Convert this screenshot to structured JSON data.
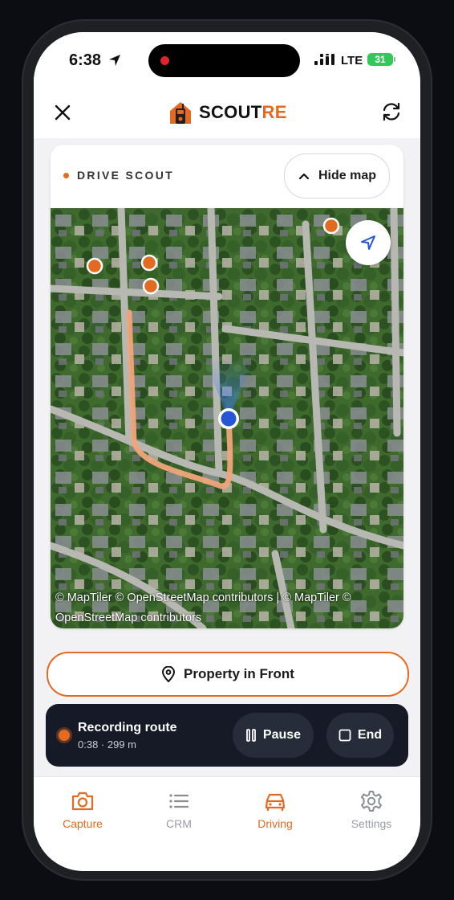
{
  "status_bar": {
    "time": "6:38",
    "network": "LTE",
    "battery": "31"
  },
  "header": {
    "brand_main": "SCOUT",
    "brand_accent": "RE"
  },
  "map_card": {
    "title": "DRIVE SCOUT",
    "hide_map_label": "Hide map",
    "attribution": "© MapTiler © OpenStreetMap contributors | © MapTiler © OpenStreetMap contributors"
  },
  "actions": {
    "property_in_front_label": "Property in Front"
  },
  "recording": {
    "title": "Recording route",
    "details": "0:38 · 299 m",
    "pause_label": "Pause",
    "end_label": "End"
  },
  "nav": {
    "items": [
      {
        "label": "Capture",
        "icon": "camera-icon",
        "active": true
      },
      {
        "label": "CRM",
        "icon": "list-icon",
        "active": false
      },
      {
        "label": "Driving",
        "icon": "car-icon",
        "active": true
      },
      {
        "label": "Settings",
        "icon": "gear-icon",
        "active": false
      }
    ]
  },
  "colors": {
    "accent": "#e36a21",
    "dark_bar": "#151a26",
    "location_dot": "#2456d6"
  }
}
